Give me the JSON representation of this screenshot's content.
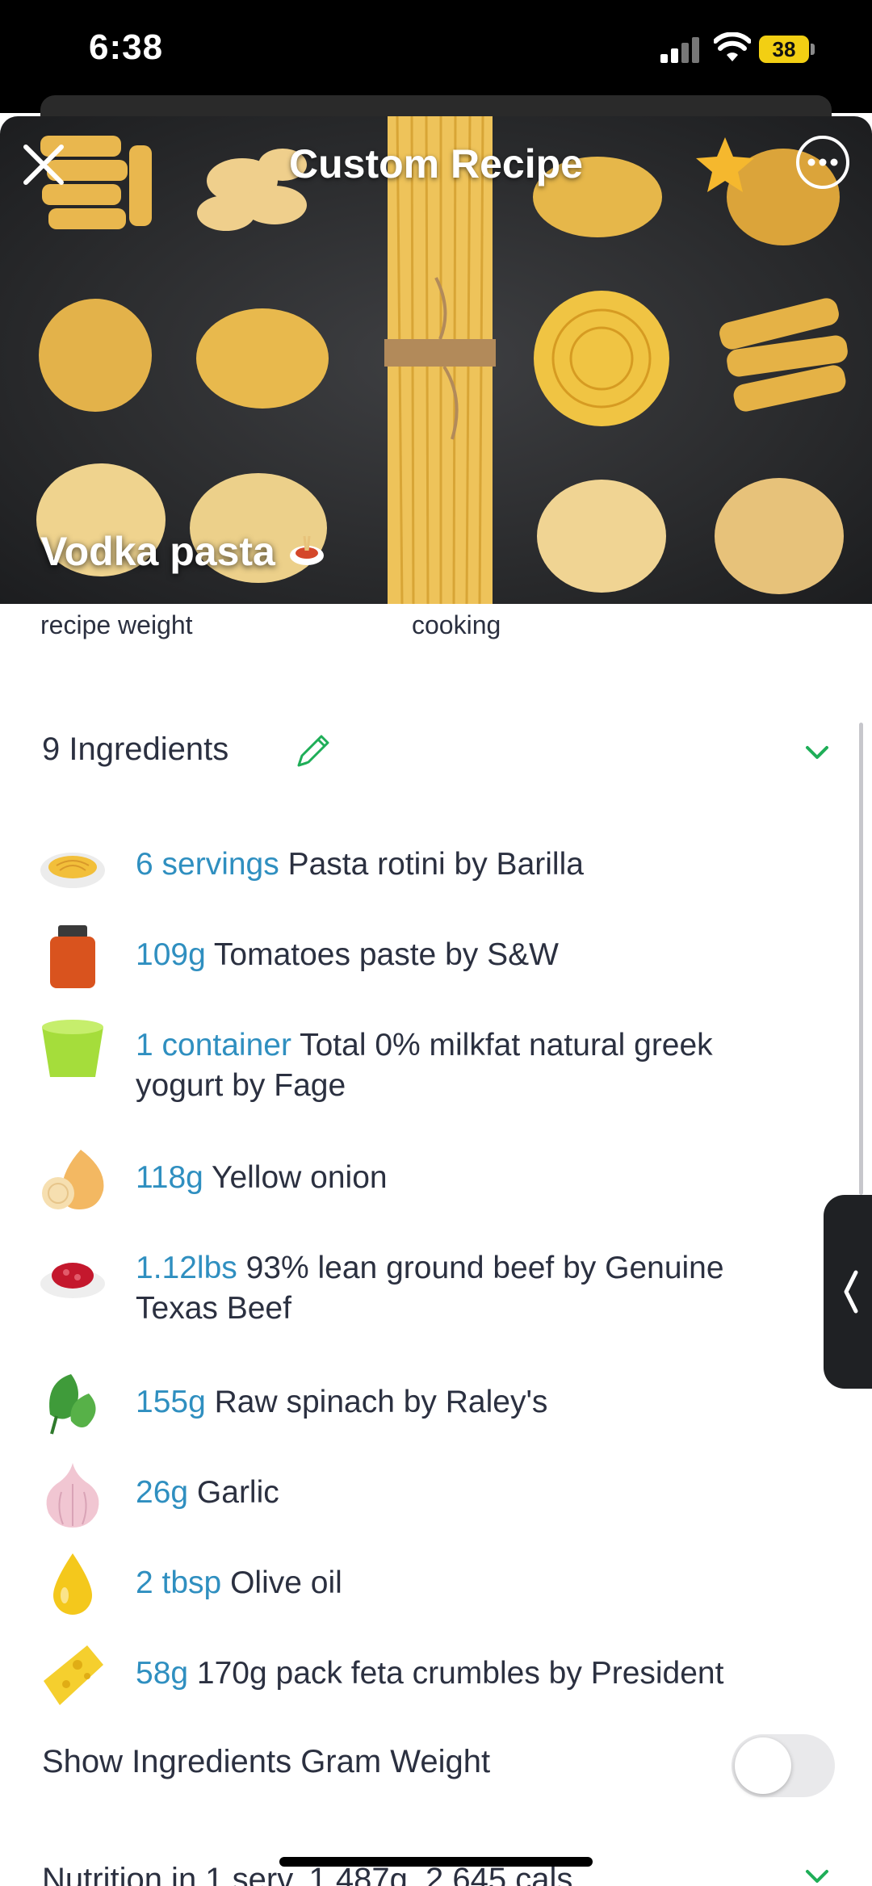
{
  "status_bar": {
    "time": "6:38",
    "battery": "38"
  },
  "header": {
    "title": "Custom Recipe"
  },
  "recipe": {
    "name": "Vodka pasta"
  },
  "meta": {
    "weight_label": "recipe weight",
    "cooking_label": "cooking"
  },
  "ingredients": {
    "header": "9 Ingredients",
    "items": [
      {
        "qty": "6 servings",
        "name": "Pasta rotini by Barilla",
        "icon": "spaghetti-plate-icon"
      },
      {
        "qty": "109g",
        "name": "Tomatoes paste by S&W",
        "icon": "jar-icon"
      },
      {
        "qty": "1 container",
        "name": "Total 0% milkfat natural greek yogurt by Fage",
        "icon": "yogurt-cup-icon"
      },
      {
        "qty": "118g",
        "name": "Yellow onion",
        "icon": "onion-icon"
      },
      {
        "qty": "1.12lbs",
        "name": "93% lean ground beef by Genuine Texas Beef",
        "icon": "ground-meat-icon"
      },
      {
        "qty": "155g",
        "name": "Raw spinach by Raley's",
        "icon": "spinach-icon"
      },
      {
        "qty": "26g",
        "name": "Garlic",
        "icon": "garlic-icon"
      },
      {
        "qty": "2 tbsp",
        "name": "Olive oil",
        "icon": "oil-drop-icon"
      },
      {
        "qty": "58g",
        "name": "170g pack feta crumbles by President",
        "icon": "cheese-icon"
      }
    ]
  },
  "options": {
    "show_gram_weight_label": "Show Ingredients Gram Weight",
    "show_gram_weight_on": false
  },
  "nutrition": {
    "summary": "Nutrition in 1 serv, 1,487g, 2,645 cals"
  },
  "colors": {
    "accent": "#1fae58",
    "quantity": "#2f8fc0",
    "star": "#f5b82e"
  }
}
